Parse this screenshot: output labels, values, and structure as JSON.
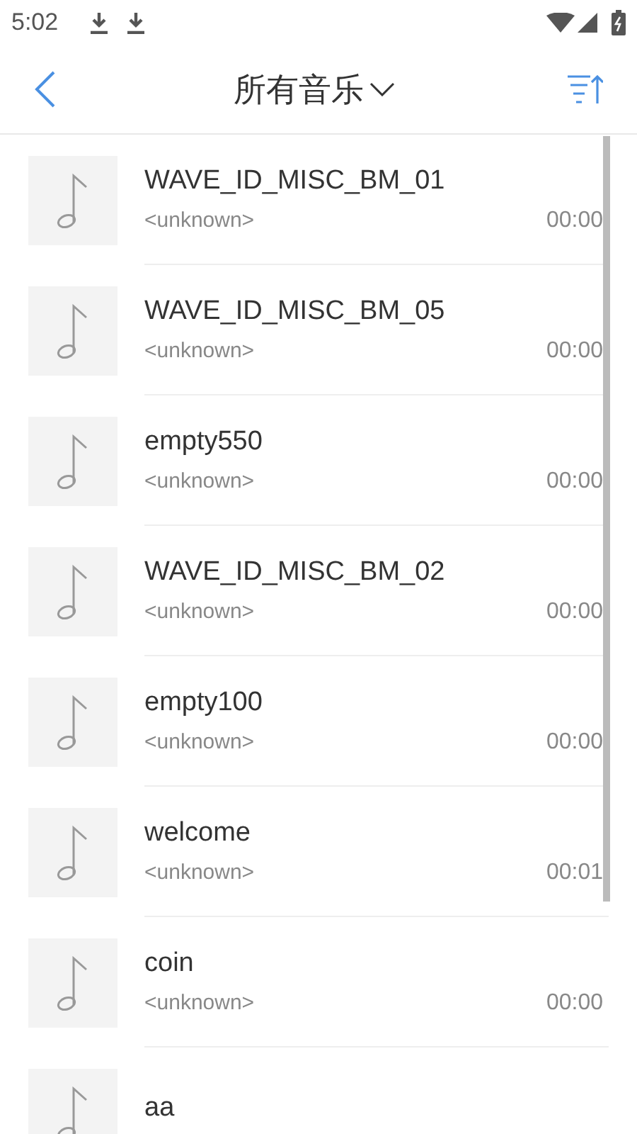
{
  "status_bar": {
    "time": "5:02"
  },
  "header": {
    "title": "所有音乐"
  },
  "songs": [
    {
      "title": "WAVE_ID_MISC_BM_01",
      "artist": "<unknown>",
      "duration": "00:00"
    },
    {
      "title": "WAVE_ID_MISC_BM_05",
      "artist": "<unknown>",
      "duration": "00:00"
    },
    {
      "title": "empty550",
      "artist": "<unknown>",
      "duration": "00:00"
    },
    {
      "title": "WAVE_ID_MISC_BM_02",
      "artist": "<unknown>",
      "duration": "00:00"
    },
    {
      "title": "empty100",
      "artist": "<unknown>",
      "duration": "00:00"
    },
    {
      "title": "welcome",
      "artist": "<unknown>",
      "duration": "00:01"
    },
    {
      "title": "coin",
      "artist": "<unknown>",
      "duration": "00:00"
    },
    {
      "title": "aa"
    }
  ]
}
